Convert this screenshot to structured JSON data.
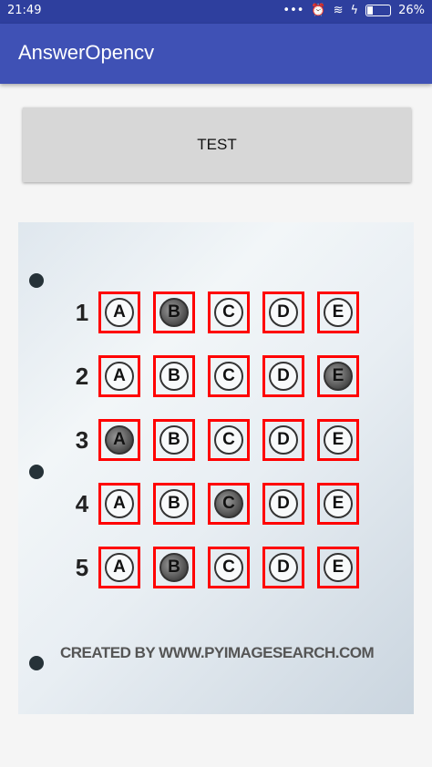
{
  "status": {
    "time": "21:49",
    "battery": "26%",
    "icons": [
      "more-icon",
      "alarm-icon",
      "wifi-icon",
      "signal-icon",
      "charging-icon",
      "battery-icon"
    ]
  },
  "app": {
    "title": "AnswerOpencv"
  },
  "button": {
    "label": "TEST"
  },
  "sheet": {
    "footer": "CREATED BY WWW.PYIMAGESEARCH.COM",
    "questions": [
      {
        "num": "1",
        "choices": [
          "A",
          "B",
          "C",
          "D",
          "E"
        ],
        "filled": "B"
      },
      {
        "num": "2",
        "choices": [
          "A",
          "B",
          "C",
          "D",
          "E"
        ],
        "filled": "E"
      },
      {
        "num": "3",
        "choices": [
          "A",
          "B",
          "C",
          "D",
          "E"
        ],
        "filled": "A"
      },
      {
        "num": "4",
        "choices": [
          "A",
          "B",
          "C",
          "D",
          "E"
        ],
        "filled": "C"
      },
      {
        "num": "5",
        "choices": [
          "A",
          "B",
          "C",
          "D",
          "E"
        ],
        "filled": "B"
      }
    ],
    "box_color": "#ff0000"
  }
}
